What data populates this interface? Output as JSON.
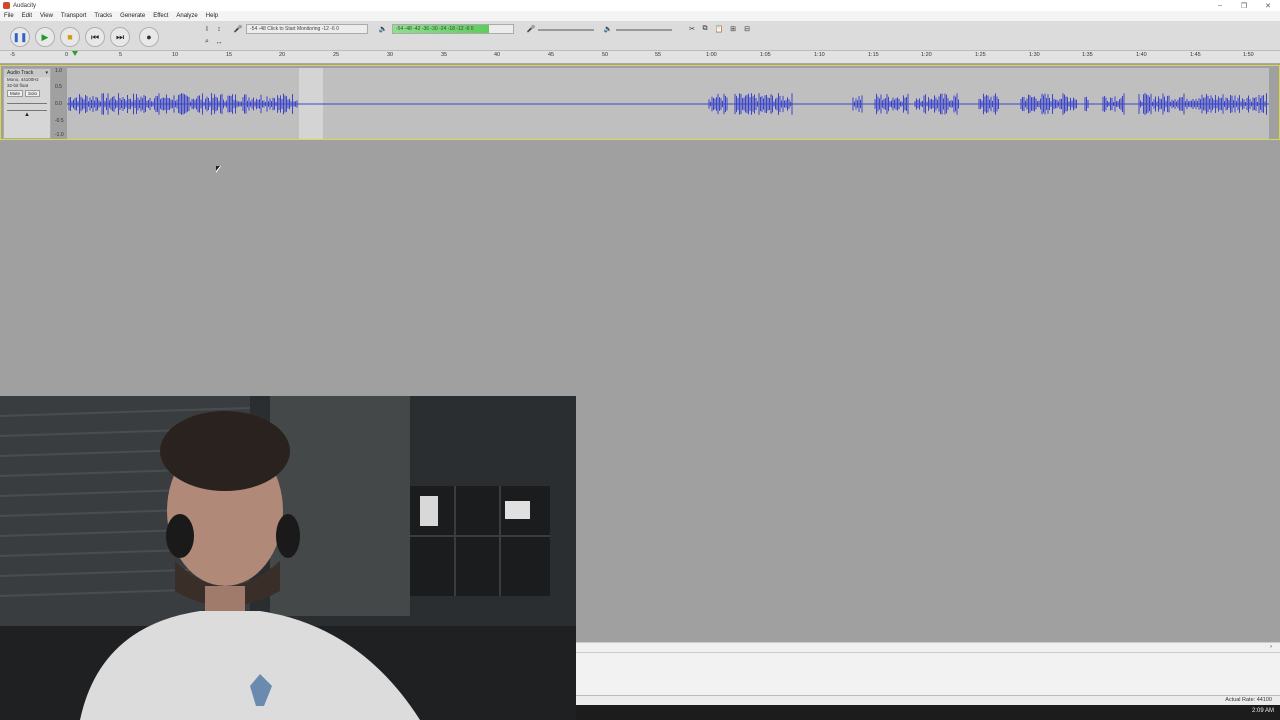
{
  "window": {
    "title": "Audacity"
  },
  "menu": [
    "File",
    "Edit",
    "View",
    "Transport",
    "Tracks",
    "Generate",
    "Effect",
    "Analyze",
    "Help"
  ],
  "toolbar": {
    "record_meter_label": "-54  -48  Click to Start Monitoring  -12  -6  0",
    "play_meter_label": "-54  -48  -42  -36  -30  -24  -18  -12  -6  0"
  },
  "ruler": {
    "ticks": [
      "-5",
      "0",
      "5",
      "10",
      "15",
      "20",
      "25",
      "30",
      "35",
      "40",
      "45",
      "50",
      "55",
      "1:00",
      "1:05",
      "1:10",
      "1:15",
      "1:20",
      "1:25",
      "1:30",
      "1:35",
      "1:40",
      "1:45",
      "1:50"
    ]
  },
  "track": {
    "name": "Audio Track",
    "info_line1": "Mono, 44100Hz",
    "info_line2": "32-bit float",
    "mute_label": "Mute",
    "solo_label": "Solo",
    "scale": [
      "1.0",
      "0.5",
      "0.0",
      "-0.5",
      "-1.0"
    ]
  },
  "status": {
    "actual_rate": "Actual Rate: 44100"
  },
  "taskbar": {
    "clock": "2:09 AM"
  },
  "colors": {
    "waveform": "#3c46c8",
    "track_border": "#d8d84a",
    "background": "#a0a0a0"
  }
}
